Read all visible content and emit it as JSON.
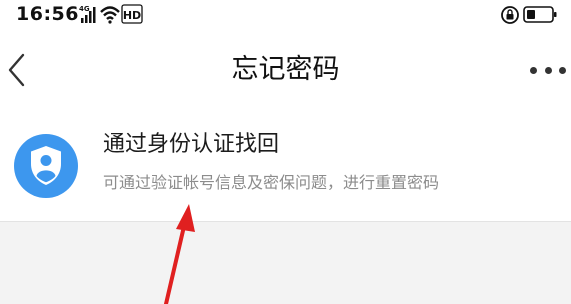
{
  "status_bar": {
    "time": "16:56",
    "network_label": "4G",
    "hd_label": "HD"
  },
  "nav": {
    "title": "忘记密码"
  },
  "options": [
    {
      "title": "通过身份认证找回",
      "subtitle": "可通过验证帐号信息及密保问题，进行重置密码",
      "icon": "shield-user-icon"
    }
  ],
  "colors": {
    "accent": "#3d97ee",
    "annotation_arrow": "#e02020",
    "page_background": "#f3f3f3"
  }
}
